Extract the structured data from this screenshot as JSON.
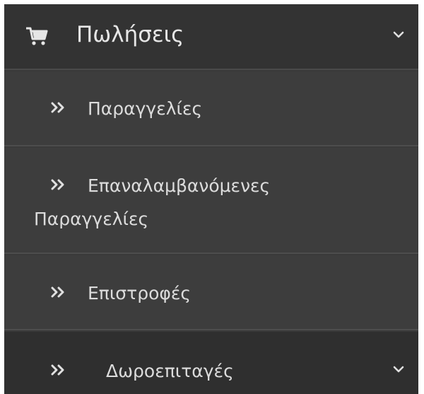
{
  "menu": {
    "sales": {
      "label": "Πωλήσεις",
      "icon": "cart-icon",
      "expanded": true
    },
    "items": [
      {
        "label": "Παραγγελίες",
        "icon": "double-chevron-right-icon"
      },
      {
        "label_line1": "Επαναλαμβανόμενες",
        "label_line2": "Παραγγελίες",
        "icon": "double-chevron-right-icon"
      },
      {
        "label": "Επιστροφές",
        "icon": "double-chevron-right-icon"
      },
      {
        "label": "Δωροεπιταγές",
        "icon": "double-chevron-right-icon",
        "expandable": true
      }
    ]
  },
  "colors": {
    "header_bg": "#333333",
    "item_bg": "#3d3d3d",
    "last_item_bg": "#2f2f2f",
    "text": "#dcdcdc",
    "divider": "#4d4d4d"
  }
}
